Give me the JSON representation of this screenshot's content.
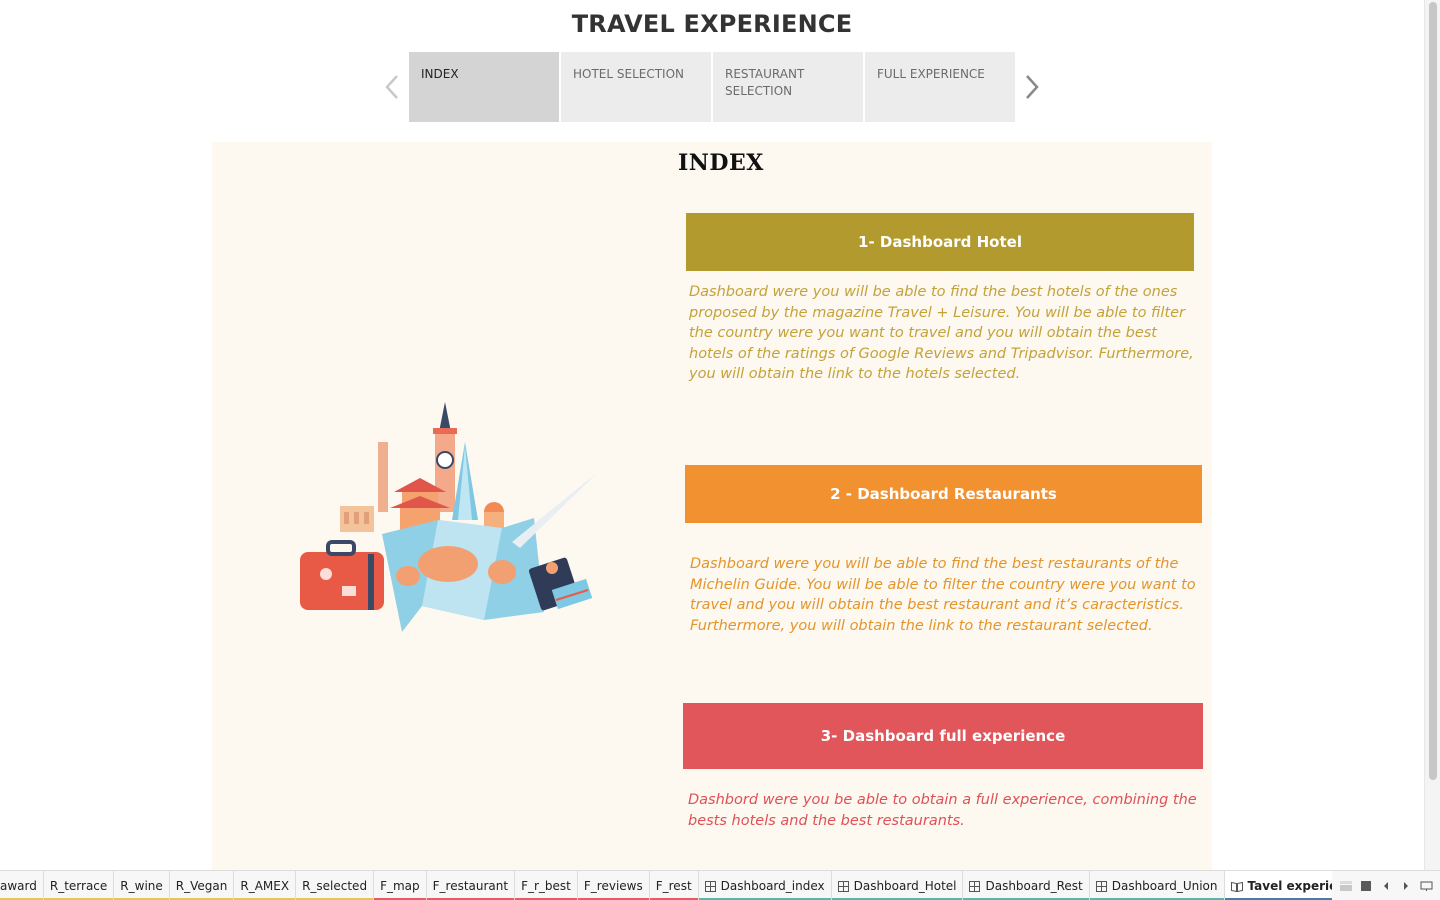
{
  "story": {
    "title": "TRAVEL EXPERIENCE",
    "points": [
      {
        "label": "INDEX",
        "active": true
      },
      {
        "label": "HOTEL SELECTION",
        "active": false
      },
      {
        "label": "RESTAURANT SELECTION",
        "active": false
      },
      {
        "label": "FULL EXPERIENCE",
        "active": false
      }
    ],
    "prev_icon": "chevron-left-icon",
    "next_icon": "chevron-right-icon"
  },
  "dashboard": {
    "heading": "INDEX",
    "sections": [
      {
        "title": "1- Dashboard Hotel",
        "color": "#b39a2e",
        "description": "Dashboard were you will be able to find the best hotels of the ones proposed by the magazine Travel + Leisure. You will be able to filter the country were you want to travel and you will obtain the best hotels of the ratings of Google Reviews and Tripadvisor. Furthermore, you will obtain the link to the hotels selected."
      },
      {
        "title": "2 - Dashboard Restaurants",
        "color": "#f1912f",
        "description": "Dashboard were you will be able to find the best restaurants of the Michelin Guide.  You will be able to filter the country were you want to travel and you will obtain the best restaurant and it’s caracteristics. Furthermore, you will obtain the link to the restaurant selected."
      },
      {
        "title": "3- Dashboard full experience",
        "color": "#e0565b",
        "description": "Dashbord were you be able to obtain a full experience, combining the bests hotels and the best restaurants."
      }
    ],
    "illustration": "travel-illustration"
  },
  "sheet_tabs": [
    {
      "label": "award",
      "type": "sheet",
      "color": "#e8c35a"
    },
    {
      "label": "R_terrace",
      "type": "sheet",
      "color": "#e8c35a"
    },
    {
      "label": "R_wine",
      "type": "sheet",
      "color": "#e8c35a"
    },
    {
      "label": "R_Vegan",
      "type": "sheet",
      "color": "#e8c35a"
    },
    {
      "label": "R_AMEX",
      "type": "sheet",
      "color": "#e8c35a"
    },
    {
      "label": "R_selected",
      "type": "sheet",
      "color": "#e8c35a"
    },
    {
      "label": "F_map",
      "type": "sheet",
      "color": "#e85a66"
    },
    {
      "label": "F_restaurant",
      "type": "sheet",
      "color": "#e85a66"
    },
    {
      "label": "F_r_best",
      "type": "sheet",
      "color": "#e85a66"
    },
    {
      "label": "F_reviews",
      "type": "sheet",
      "color": "#e85a66"
    },
    {
      "label": "F_rest",
      "type": "sheet",
      "color": "#e85a66"
    },
    {
      "label": "Dashboard_index",
      "type": "dashboard",
      "color": "#5bb5a8"
    },
    {
      "label": "Dashboard_Hotel",
      "type": "dashboard",
      "color": "#5bb5a8"
    },
    {
      "label": "Dashboard_Rest",
      "type": "dashboard",
      "color": "#5bb5a8"
    },
    {
      "label": "Dashboard_Union",
      "type": "dashboard",
      "color": "#5bb5a8"
    },
    {
      "label": "Tavel experience",
      "type": "story",
      "color": "#4e79a7",
      "active": true
    }
  ],
  "tab_tools": [
    "filmstrip-icon",
    "tab-view-icon",
    "scroll-left-icon",
    "scroll-right-icon",
    "show-sheets-icon"
  ]
}
